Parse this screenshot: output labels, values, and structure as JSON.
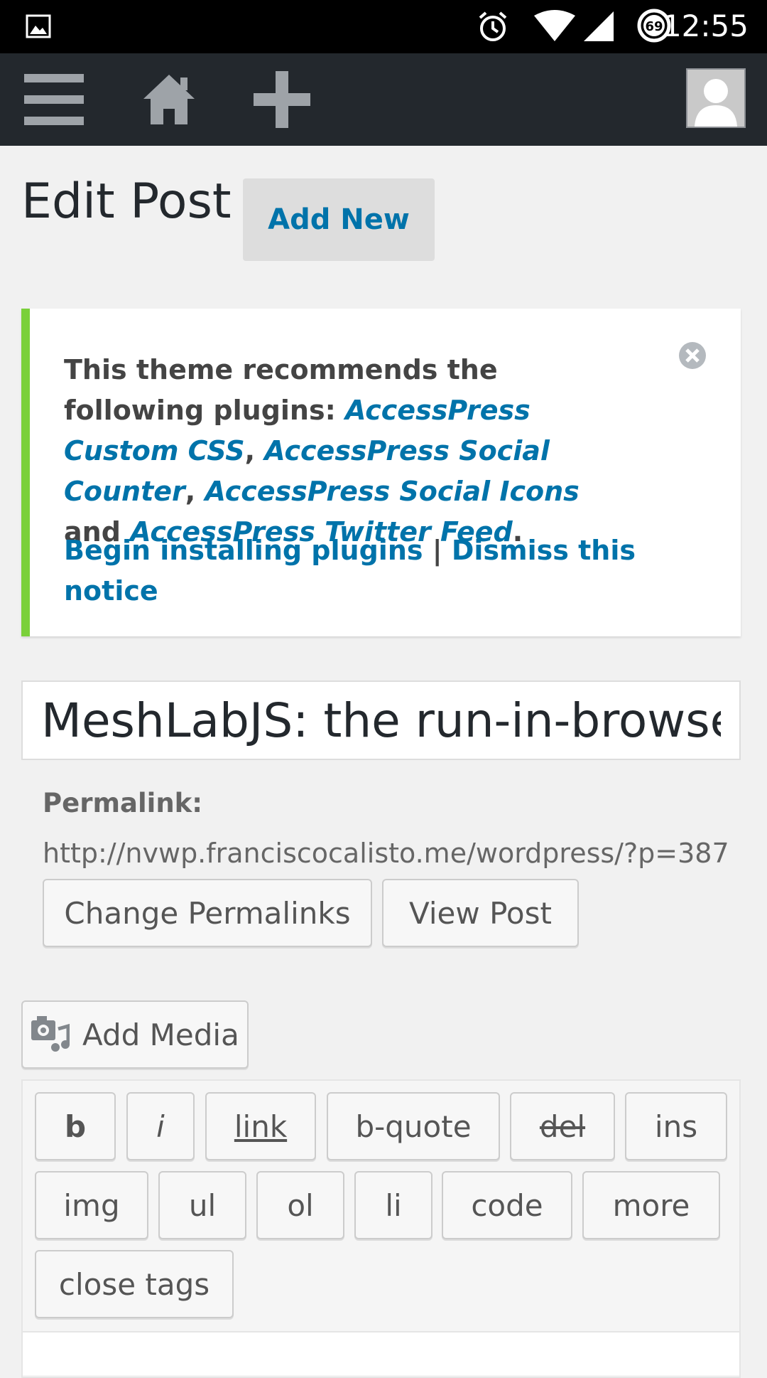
{
  "status_bar": {
    "time": "12:55",
    "battery_level": "69",
    "icons": [
      "image-icon",
      "alarm-icon",
      "wifi-icon",
      "signal-icon",
      "battery-icon"
    ]
  },
  "admin_bar": {
    "icons": [
      "menu-icon",
      "home-icon",
      "plus-icon",
      "avatar-icon"
    ]
  },
  "page": {
    "title": "Edit Post",
    "add_new_label": "Add New"
  },
  "notice": {
    "prefix": "This theme recommends the following plugins: ",
    "plugin1": "AccessPress Custom CSS",
    "sep1": ", ",
    "plugin2": "AccessPress Social Counter",
    "sep2": ", ",
    "plugin3": "AccessPress Social Icons",
    "sep3": " and ",
    "plugin4": "AccessPress Twitter Feed",
    "end": ".",
    "begin_label": "Begin installing plugins",
    "divider": " | ",
    "dismiss_label": "Dismiss this notice"
  },
  "post": {
    "title_value": "MeshLabJS: the run-in-browser"
  },
  "permalink": {
    "label": "Permalink:",
    "url": "http://nvwp.franciscocalisto.me/wordpress/?p=387",
    "change_label": "Change Permalinks",
    "view_label": "View Post"
  },
  "editor": {
    "add_media_label": "Add Media",
    "quicktags": [
      "b",
      "i",
      "link",
      "b-quote",
      "del",
      "ins",
      "img",
      "ul",
      "ol",
      "li",
      "code",
      "more",
      "close tags"
    ]
  },
  "colors": {
    "admin_bar": "#23282d",
    "link": "#0073aa",
    "notice_accent": "#7ad03a",
    "background": "#f1f1f1"
  }
}
